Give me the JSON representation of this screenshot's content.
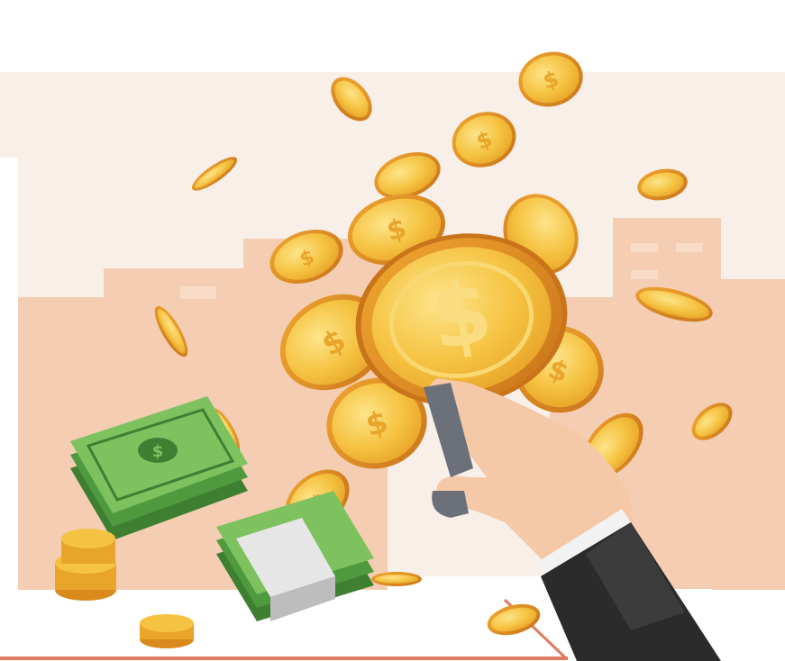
{
  "illustration": {
    "subject": "money-rain",
    "coin_symbol": "$",
    "colors": {
      "sky": "#f7efe8",
      "building": "#f4cdb2",
      "building_light": "#f8dcc7",
      "floor": "#ffffff",
      "coin": "#f5c341",
      "coin_dark": "#d98a1a",
      "coin_rim": "#e8a52a",
      "cash": "#4f9a3f",
      "cash_light": "#7dc25f",
      "sleeve": "#2b2b2b",
      "cuff": "#f2f2f2",
      "skin": "#f5c8a8",
      "accent_line": "#e07b5d"
    }
  }
}
